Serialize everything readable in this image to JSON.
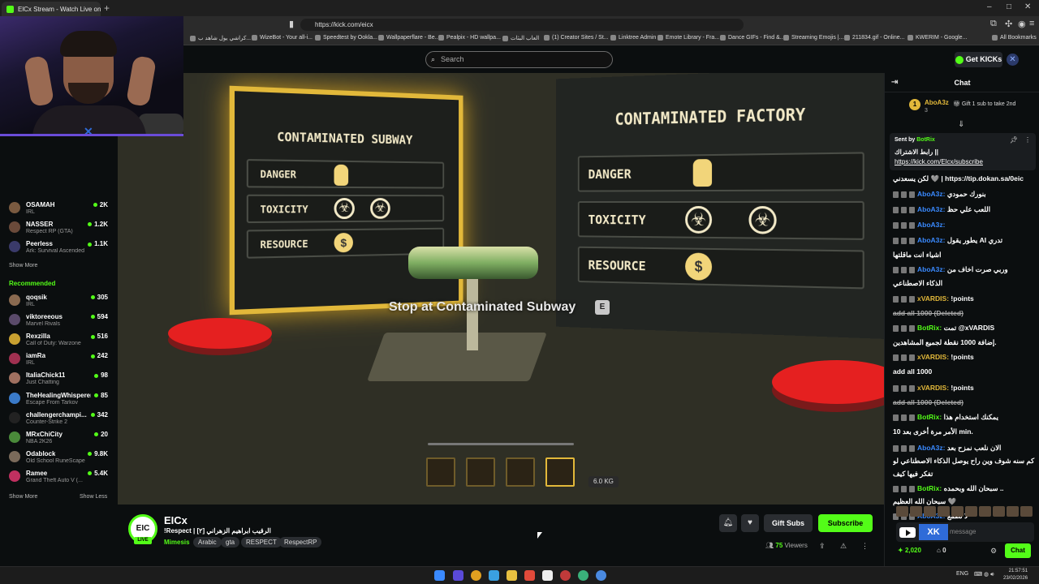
{
  "browser": {
    "tab_title": "ElCx Stream - Watch Live on K",
    "url": "https://kick.com/eicx",
    "bookmarks": [
      "كراشي يول شاهد ب...",
      "WizeBot - Your all-i...",
      "Speedtest by Ookla...",
      "Wallpaperflare - Be...",
      "Pealpix - HD wallpa...",
      "العاب البثات",
      "(1) Creator Sites / St...",
      "Linktree Admin",
      "Emote Library - Fra...",
      "Dance GIFs - Find &...",
      "Streaming Emojis |...",
      "211834.gif - Online...",
      "KWERIM - Google...",
      "All Bookmarks"
    ]
  },
  "header": {
    "search_placeholder": "Search",
    "get_kicks": "Get KICKs"
  },
  "sidebar": {
    "following": [
      {
        "name": "OSAMAH",
        "category": "IRL",
        "viewers": "2K",
        "color": "#7a5a40"
      },
      {
        "name": "NASSER",
        "category": "Respect RP (GTA)",
        "viewers": "1.2K",
        "color": "#6a4a3a"
      },
      {
        "name": "Peerless",
        "category": "Ark: Survival Ascended",
        "viewers": "1.1K",
        "color": "#3a3a6a"
      }
    ],
    "show_more": "Show More",
    "recommended_label": "Recommended",
    "recommended": [
      {
        "name": "qoqsik",
        "category": "IRL",
        "viewers": "305",
        "color": "#8a6a50"
      },
      {
        "name": "viktoreeous",
        "category": "Marvel Rivals",
        "viewers": "594",
        "color": "#5a4a6a"
      },
      {
        "name": "Rexzilla",
        "category": "Call of Duty: Warzone",
        "viewers": "516",
        "color": "#c8a030"
      },
      {
        "name": "iamRa",
        "category": "IRL",
        "viewers": "242",
        "color": "#a03050"
      },
      {
        "name": "ItaliaChick11",
        "category": "Just Chatting",
        "viewers": "98",
        "color": "#a07060"
      },
      {
        "name": "TheHealingWhisperer",
        "category": "Escape From Tarkov",
        "viewers": "85",
        "color": "#3a7ac8"
      },
      {
        "name": "challengerchampi...",
        "category": "Counter-Strike 2",
        "viewers": "342",
        "color": "#222"
      },
      {
        "name": "MRxChiCity",
        "category": "NBA 2K26",
        "viewers": "20",
        "color": "#4a8a3a"
      },
      {
        "name": "Odablock",
        "category": "Old School RuneScape",
        "viewers": "9.8K",
        "color": "#7a6a5a"
      },
      {
        "name": "Ramee",
        "category": "Grand Theft Auto V (...",
        "viewers": "5.4K",
        "color": "#c03060"
      }
    ],
    "show_less": "Show Less"
  },
  "game": {
    "left_panel_title": "CONTAMINATED SUBWAY",
    "right_panel_title": "CONTAMINATED FACTORY",
    "rows": [
      "DANGER",
      "TOXICITY",
      "RESOURCE"
    ],
    "prompt": "Stop at Contaminated Subway",
    "key": "E",
    "weight": "6.0 KG"
  },
  "stream": {
    "avatar_text": "EIC",
    "live_label": "LIVE",
    "channel": "EICx",
    "title": "!Respect | [٢] الرقيب ابراهيم الزهراني",
    "category": "Mimesis",
    "tags": [
      "Arabic",
      "gta",
      "RESPECT",
      "RespectRP"
    ],
    "gift_subs": "Gift Subs",
    "subscribe": "Subscribe",
    "viewers_count": "75",
    "viewers_label": "Viewers"
  },
  "chat": {
    "title": "Chat",
    "leader_rank": "1",
    "leader_name": "AboA3z",
    "leader_count": "3",
    "leader_gift": "Gift 1 sub to take 2nd",
    "pinned_sent_by": "Sent by",
    "pinned_bot": "BotRix",
    "pinned_msg": "رابط الاشتراك ||",
    "pinned_link": "https://kick.com/Elcx/subscribe",
    "messages": [
      {
        "user": "",
        "ucolor": "#fff",
        "text": "لكن يسعدني 🩶 | https://tip.dokan.sa/0eic",
        "del": false
      },
      {
        "user": "AboA3z:",
        "ucolor": "#3a8aff",
        "text": "بنورك حمودي",
        "del": false
      },
      {
        "user": "AboA3z:",
        "ucolor": "#3a8aff",
        "text": "اللعب علي حظ",
        "del": false
      },
      {
        "user": "AboA3z:",
        "ucolor": "#3a8aff",
        "text": "",
        "del": false
      },
      {
        "user": "AboA3z:",
        "ucolor": "#3a8aff",
        "text": "يطور يقول AI تدري",
        "del": false
      },
      {
        "user": "",
        "ucolor": "#fff",
        "text": "اشياء انت ماقلتها",
        "del": false
      },
      {
        "user": "AboA3z:",
        "ucolor": "#3a8aff",
        "text": "وربي صرت اخاف من",
        "del": false
      },
      {
        "user": "",
        "ucolor": "#fff",
        "text": "الذكاء الاصطناعي",
        "del": false
      },
      {
        "user": "xVARDIS:",
        "ucolor": "#e2b83a",
        "text": "!points",
        "del": false
      },
      {
        "user": "",
        "ucolor": "#fff",
        "text": "add all 1000 (Deleted)",
        "del": true
      },
      {
        "user": "BotRix:",
        "ucolor": "#53fc18",
        "text": "تمت @xVARDIS",
        "del": false
      },
      {
        "user": "",
        "ucolor": "#fff",
        "text": "إضافة 1000 نقطة لجميع المشاهدين.",
        "del": false
      },
      {
        "user": "xVARDIS:",
        "ucolor": "#e2b83a",
        "text": "!points",
        "del": false
      },
      {
        "user": "",
        "ucolor": "#fff",
        "text": "add all 1000",
        "del": false
      },
      {
        "user": "xVARDIS:",
        "ucolor": "#e2b83a",
        "text": "!points",
        "del": false
      },
      {
        "user": "",
        "ucolor": "#fff",
        "text": "add all 1000 (Deleted)",
        "del": true
      },
      {
        "user": "BotRix:",
        "ucolor": "#53fc18",
        "text": "يمكنك استخدام هذا",
        "del": false
      },
      {
        "user": "",
        "ucolor": "#fff",
        "text": "الأمر مرة أخرى بعد 10 min.",
        "del": false
      },
      {
        "user": "AboA3z:",
        "ucolor": "#3a8aff",
        "text": "الان نلعب نمزح بعد",
        "del": false
      },
      {
        "user": "",
        "ucolor": "#fff",
        "text": "كم سنه شوف وين راح يوصل الذكاء الاصطناعي لو",
        "del": false
      },
      {
        "user": "",
        "ucolor": "#fff",
        "text": "تفكر فيها كيف",
        "del": false
      },
      {
        "user": "BotRix:",
        "ucolor": "#53fc18",
        "text": "سبحان الله وبحمده ..",
        "del": false
      },
      {
        "user": "",
        "ucolor": "#fff",
        "text": "سبحان الله العظيم 🩶",
        "del": false
      },
      {
        "user": "AboA3z:",
        "ucolor": "#3a8aff",
        "text": "لا تطمع",
        "del": false
      }
    ],
    "input_placeholder": "message",
    "points": "2,020",
    "points_secondary": "0",
    "chat_button": "Chat"
  },
  "taskbar": {
    "lang": "ENG",
    "time": "21:57:51",
    "date": "23/02/2026"
  }
}
